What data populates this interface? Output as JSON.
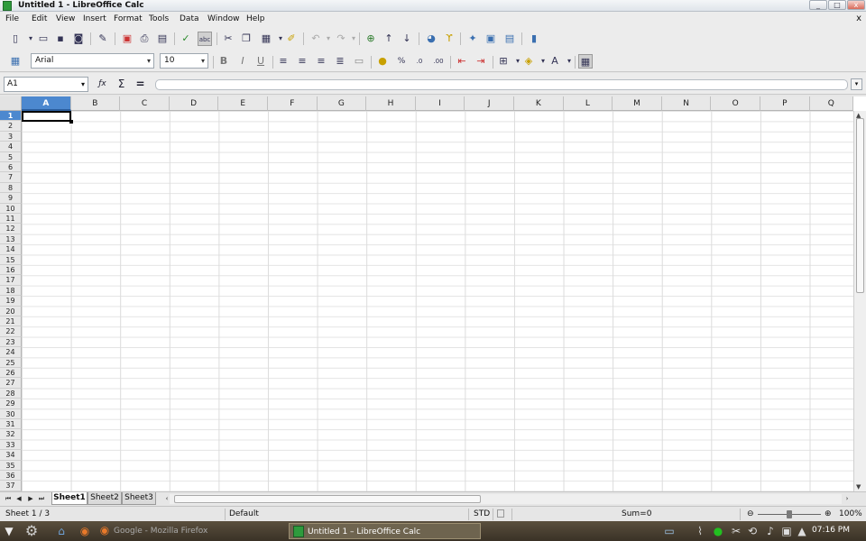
{
  "window": {
    "title": "Untitled 1 - LibreOffice Calc",
    "controls": [
      "_",
      "□",
      "x"
    ]
  },
  "menubar": {
    "items": [
      "File",
      "Edit",
      "View",
      "Insert",
      "Format",
      "Tools",
      "Data",
      "Window",
      "Help"
    ],
    "close_glyph": "x"
  },
  "toolbar": {
    "font_name": "Arial",
    "font_size": "10"
  },
  "formula": {
    "name_box": "A1",
    "input_value": ""
  },
  "columns": [
    "A",
    "B",
    "C",
    "D",
    "E",
    "F",
    "G",
    "H",
    "I",
    "J",
    "K",
    "L",
    "M",
    "N",
    "O",
    "P",
    "Q"
  ],
  "rows": [
    "1",
    "2",
    "3",
    "4",
    "5",
    "6",
    "7",
    "8",
    "9",
    "10",
    "11",
    "12",
    "13",
    "14",
    "15",
    "16",
    "17",
    "18",
    "19",
    "20",
    "21",
    "22",
    "23",
    "24",
    "25",
    "26",
    "27",
    "28",
    "29",
    "30",
    "31",
    "32",
    "33",
    "34",
    "35",
    "36",
    "37"
  ],
  "active_cell": {
    "col": "A",
    "row": "1"
  },
  "sheets": {
    "tabs": [
      "Sheet1",
      "Sheet2",
      "Sheet3"
    ],
    "active": "Sheet1"
  },
  "status": {
    "sheet_position": "Sheet 1 / 3",
    "page_style": "Default",
    "selection_mode": "STD",
    "sum": "Sum=0",
    "zoom": "100%"
  },
  "taskbar": {
    "windows": [
      "Google - Mozilla Firefox",
      "Untitled 1 – LibreOffice Calc"
    ],
    "active_window": "Untitled 1 – LibreOffice Calc",
    "clock": "07:16 PM"
  },
  "colors": {
    "selection": "#4c88cf",
    "app_icon": "#2e9b3d",
    "taskbar": "#4a4032"
  }
}
